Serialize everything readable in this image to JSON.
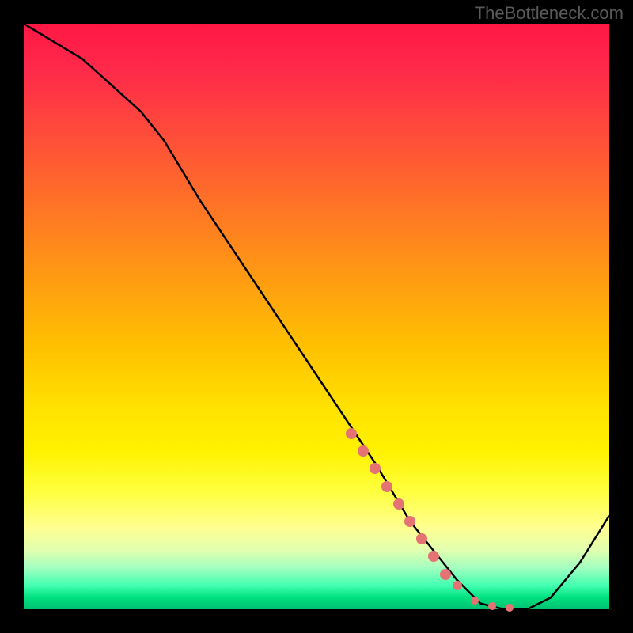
{
  "watermark": "TheBottleneck.com",
  "chart_data": {
    "type": "line",
    "title": "",
    "xlabel": "",
    "ylabel": "",
    "x_range": [
      0,
      100
    ],
    "y_range": [
      0,
      100
    ],
    "series": [
      {
        "name": "curve",
        "x": [
          0,
          10,
          20,
          24,
          30,
          40,
          50,
          60,
          66,
          70,
          74,
          78,
          82,
          86,
          90,
          95,
          100
        ],
        "y": [
          100,
          94,
          85,
          80,
          70,
          55,
          40,
          25,
          15,
          10,
          5,
          1,
          0,
          0,
          2,
          8,
          16
        ]
      }
    ],
    "markers": {
      "name": "thick-segment",
      "color": "#e57373",
      "points": [
        {
          "x": 56,
          "y": 30
        },
        {
          "x": 58,
          "y": 27
        },
        {
          "x": 60,
          "y": 24
        },
        {
          "x": 62,
          "y": 21
        },
        {
          "x": 64,
          "y": 18
        },
        {
          "x": 66,
          "y": 15
        },
        {
          "x": 68,
          "y": 12
        },
        {
          "x": 70,
          "y": 9
        },
        {
          "x": 72,
          "y": 6
        },
        {
          "x": 74,
          "y": 4
        },
        {
          "x": 77,
          "y": 1.5
        },
        {
          "x": 80,
          "y": 0.5
        },
        {
          "x": 83,
          "y": 0.3
        }
      ]
    },
    "background_gradient": {
      "top": "#ff1744",
      "middle": "#ffe000",
      "bottom": "#00c070"
    }
  }
}
